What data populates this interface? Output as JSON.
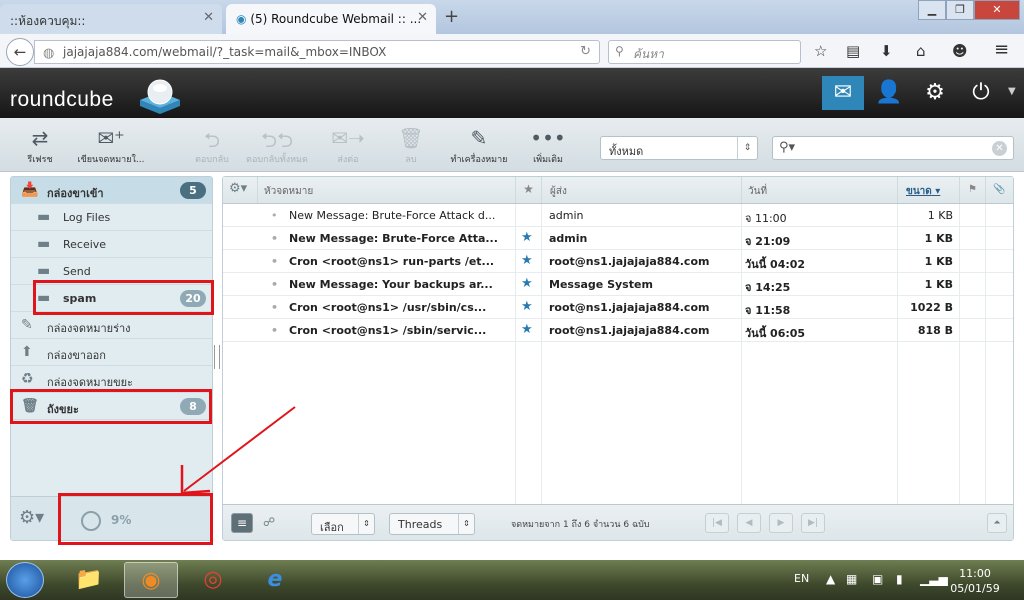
{
  "browser": {
    "tabs": [
      {
        "label": "::ห้องควบคุม::"
      },
      {
        "label": "(5) Roundcube Webmail :: ..."
      }
    ],
    "url": "jajajaja884.com/webmail/?_task=mail&_mbox=INBOX",
    "search_placeholder": "ค้นหา"
  },
  "app": {
    "logo": "roundcube"
  },
  "toolbar": {
    "buttons": [
      {
        "label": "รีเฟรช",
        "icon": "refresh-icon"
      },
      {
        "label": "เขียนจดหมายใ...",
        "icon": "compose-icon"
      },
      {
        "label": "ตอบกลับ",
        "icon": "reply-icon"
      },
      {
        "label": "ตอบกลับทั้งหมด",
        "icon": "reply-all-icon"
      },
      {
        "label": "ส่งต่อ",
        "icon": "forward-icon"
      },
      {
        "label": "ลบ",
        "icon": "trash-icon"
      },
      {
        "label": "ทำเครื่องหมาย",
        "icon": "mark-icon"
      },
      {
        "label": "เพิ่มเติม",
        "icon": "more-icon"
      }
    ],
    "filter_value": "ทั้งหมด"
  },
  "folders": [
    {
      "label": "กล่องขาเข้า",
      "count": "5"
    },
    {
      "label": "Log Files",
      "count": ""
    },
    {
      "label": "Receive",
      "count": ""
    },
    {
      "label": "Send",
      "count": ""
    },
    {
      "label": "spam",
      "count": "20"
    },
    {
      "label": "กล่องจดหมายร่าง",
      "count": ""
    },
    {
      "label": "กล่องขาออก",
      "count": ""
    },
    {
      "label": "กล่องจดหมายขยะ",
      "count": ""
    },
    {
      "label": "ถังขยะ",
      "count": "8"
    }
  ],
  "quota": "9%",
  "list": {
    "headers": {
      "subject": "หัวจดหมาย",
      "from": "ผู้ส่ง",
      "date": "วันที่",
      "size": "ขนาด"
    },
    "rows": [
      {
        "subject": "New Message: Brute-Force Attack d...",
        "from": "admin",
        "date": "จ 11:00",
        "size": "1 KB"
      },
      {
        "subject": "New Message: Brute-Force Atta...",
        "from": "admin",
        "date": "จ 21:09",
        "size": "1 KB"
      },
      {
        "subject": "Cron <root@ns1> run-parts /et...",
        "from": "root@ns1.jajajaja884.com",
        "date": "วันนี้ 04:02",
        "size": "1 KB"
      },
      {
        "subject": "New Message: Your backups ar...",
        "from": "Message System",
        "date": "จ 14:25",
        "size": "1 KB"
      },
      {
        "subject": "Cron <root@ns1> /usr/sbin/cs...",
        "from": "root@ns1.jajajaja884.com",
        "date": "จ 11:58",
        "size": "1022 B"
      },
      {
        "subject": "Cron <root@ns1> /sbin/servic...",
        "from": "root@ns1.jajajaja884.com",
        "date": "วันนี้ 06:05",
        "size": "818 B"
      }
    ],
    "select_label": "เลือก",
    "threads_label": "Threads",
    "count_text": "จดหมายจาก 1 ถึง 6 จำนวน 6 ฉบับ"
  },
  "taskbar": {
    "lang": "EN",
    "time": "11:00",
    "date": "05/01/59"
  },
  "colors": {
    "accent": "#2e87b8",
    "highlight_box": "#e0151b"
  }
}
